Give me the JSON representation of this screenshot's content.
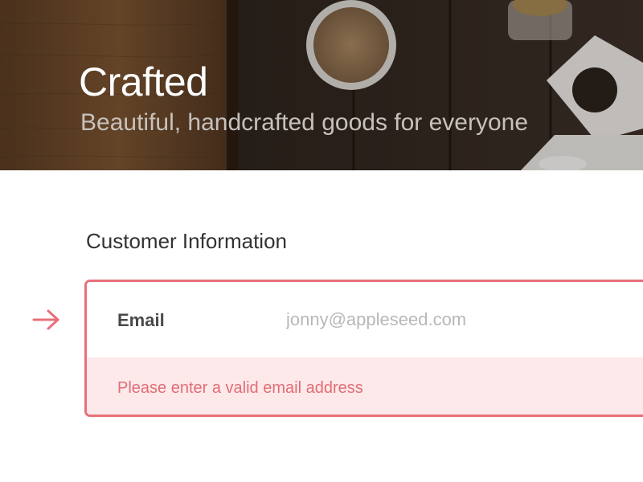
{
  "hero": {
    "title": "Crafted",
    "subtitle": "Beautiful, handcrafted goods for everyone",
    "background_image": "wooden-table-with-spice-bowls-photo"
  },
  "form": {
    "section_heading": "Customer Information",
    "pointer_icon": "arrow-right-icon",
    "email_field": {
      "label": "Email",
      "value": "",
      "placeholder": "jonny@appleseed.com",
      "state": "error",
      "error_message": "Please enter a valid email address"
    }
  },
  "colors": {
    "error_accent": "#e8707a",
    "error_background": "#fde9ea",
    "error_text": "#e26d75",
    "heading_text": "#333333",
    "label_text": "#4a4a4a",
    "placeholder_text": "#b8b8b8",
    "hero_title": "#ffffff",
    "hero_subtitle": "#c7c1bc"
  }
}
